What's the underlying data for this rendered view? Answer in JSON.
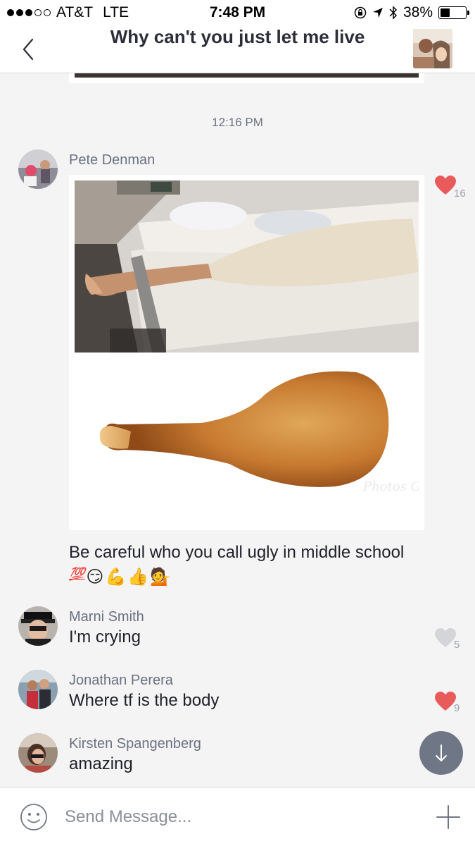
{
  "status_bar": {
    "carrier": "AT&T",
    "network": "LTE",
    "time": "7:48 PM",
    "battery": "38%",
    "battery_level": 0.38,
    "signal_bars_filled": 3,
    "signal_bars_total": 5
  },
  "header": {
    "title": "Why can't you just let me live"
  },
  "chat": {
    "timestamp": "12:16 PM",
    "messages": [
      {
        "sender": "Pete Denman",
        "caption": "Be careful who you call ugly in middle school",
        "emojis": [
          "💯",
          "😏",
          "💪",
          "👍",
          "💁"
        ],
        "like_count": "16",
        "liked": true,
        "watermark": "Photos Grad"
      },
      {
        "sender": "Marni Smith",
        "text": "I'm crying",
        "like_count": "5",
        "liked": false
      },
      {
        "sender": "Jonathan Perera",
        "text": "Where tf is the body",
        "like_count": "9",
        "liked": true
      },
      {
        "sender": "Kirsten Spangenberg",
        "text": "amazing"
      }
    ]
  },
  "composer": {
    "placeholder": "Send Message..."
  },
  "colors": {
    "heart_liked": "#e95b5b",
    "heart_unliked": "#d3d5d9",
    "scroll_button": "#6f7787",
    "background": "#f4f4f5"
  },
  "icons": {
    "back": "chevron-left-icon",
    "location": "location-arrow-icon",
    "bluetooth": "bluetooth-icon",
    "orientation_lock": "orientation-lock-icon",
    "like": "heart-icon",
    "scroll": "arrow-down-icon",
    "emoji": "smiley-icon",
    "add": "plus-icon"
  }
}
